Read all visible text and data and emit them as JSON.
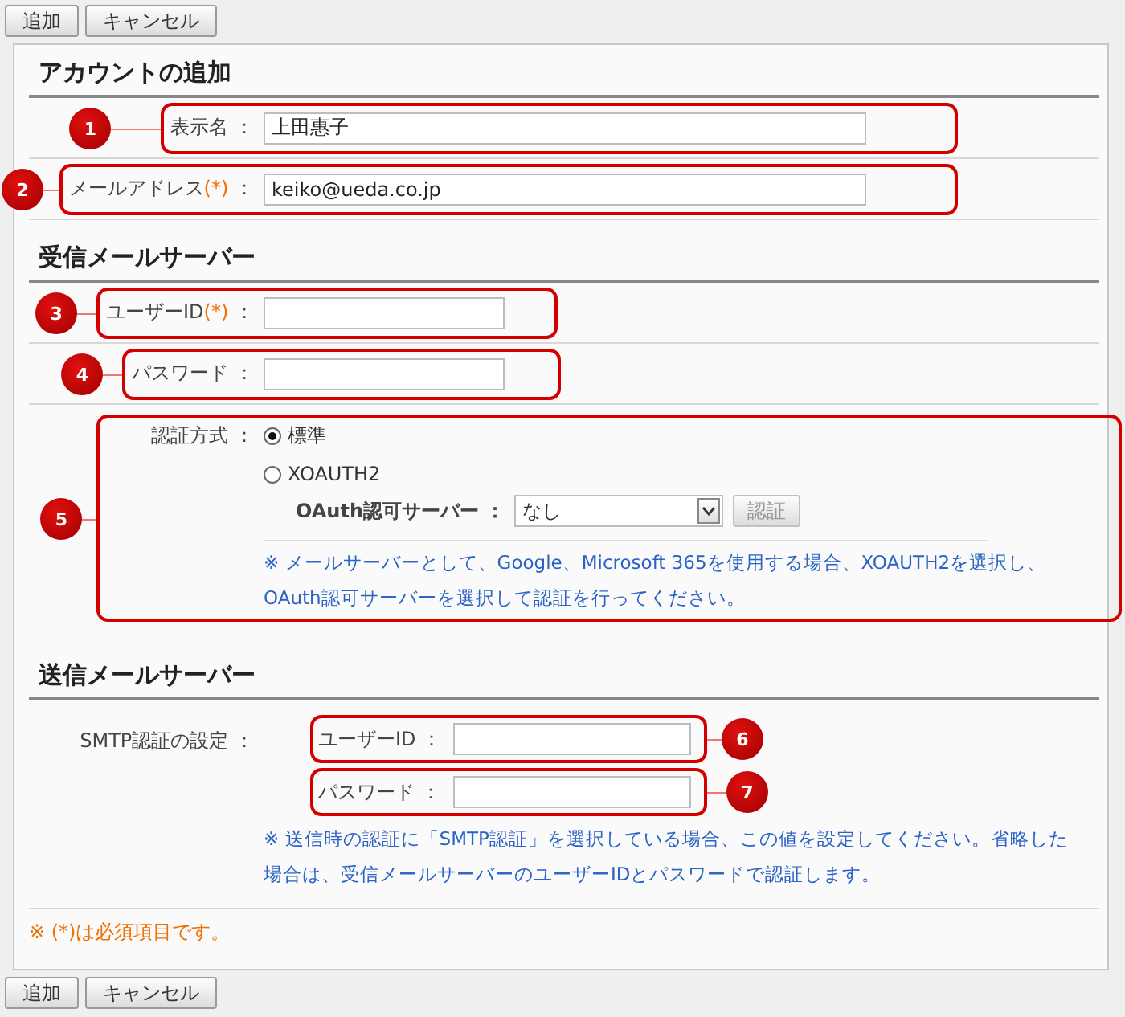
{
  "toolbar_top": {
    "buttons": [
      "追加",
      "キャンセル"
    ]
  },
  "sections": [
    {
      "title": "アカウントの追加",
      "rows": [
        {
          "kind": "field",
          "label": "表示名",
          "colon": "：",
          "value": "上田惠子"
        },
        {
          "kind": "field",
          "label": "メールアドレス",
          "mark": "(*)",
          "colon": "：",
          "value": "keiko@ueda.co.jp"
        }
      ]
    },
    {
      "title": "受信メールサーバー",
      "rows": [
        {
          "kind": "field",
          "label": "ユーザーID",
          "mark": "(*)",
          "colon": "："
        },
        {
          "kind": "field",
          "label": "パスワード",
          "colon": "："
        },
        {
          "kind": "auth",
          "label": "認証方式",
          "colon": "：",
          "options": [
            {
              "label": "標準",
              "selected": true
            },
            {
              "label": "XOAUTH2",
              "selected": false
            }
          ],
          "server": {
            "label": "OAuth認可サーバー",
            "colon": "：",
            "value": "なし",
            "button": {
              "label": "認証",
              "disabled": true
            }
          },
          "note": "※ メールサーバーとして、Google、Microsoft 365を使用する場合、XOAUTH2を選択し、OAuth認可サーバーを選択して認証を行ってください。"
        }
      ]
    },
    {
      "title": "送信メールサーバー",
      "rows": [
        {
          "kind": "smtp",
          "label": "SMTP認証の設定",
          "colon": "：",
          "fields": [
            {
              "label": "ユーザーID",
              "colon": "："
            },
            {
              "label": "パスワード",
              "colon": "："
            }
          ],
          "note": "※ 送信時の認証に「SMTP認証」を選択している場合、この値を設定してください。省略した場合は、受信メールサーバーのユーザーIDとパスワードで認証します。"
        }
      ]
    }
  ],
  "required_note": "※ (*)は必須項目です。",
  "toolbar_bottom": {
    "buttons": [
      "追加",
      "キャンセル"
    ]
  },
  "callouts": [
    {
      "number": "1"
    },
    {
      "number": "2"
    },
    {
      "number": "3"
    },
    {
      "number": "4"
    },
    {
      "number": "5"
    },
    {
      "number": "6"
    },
    {
      "number": "7"
    }
  ]
}
